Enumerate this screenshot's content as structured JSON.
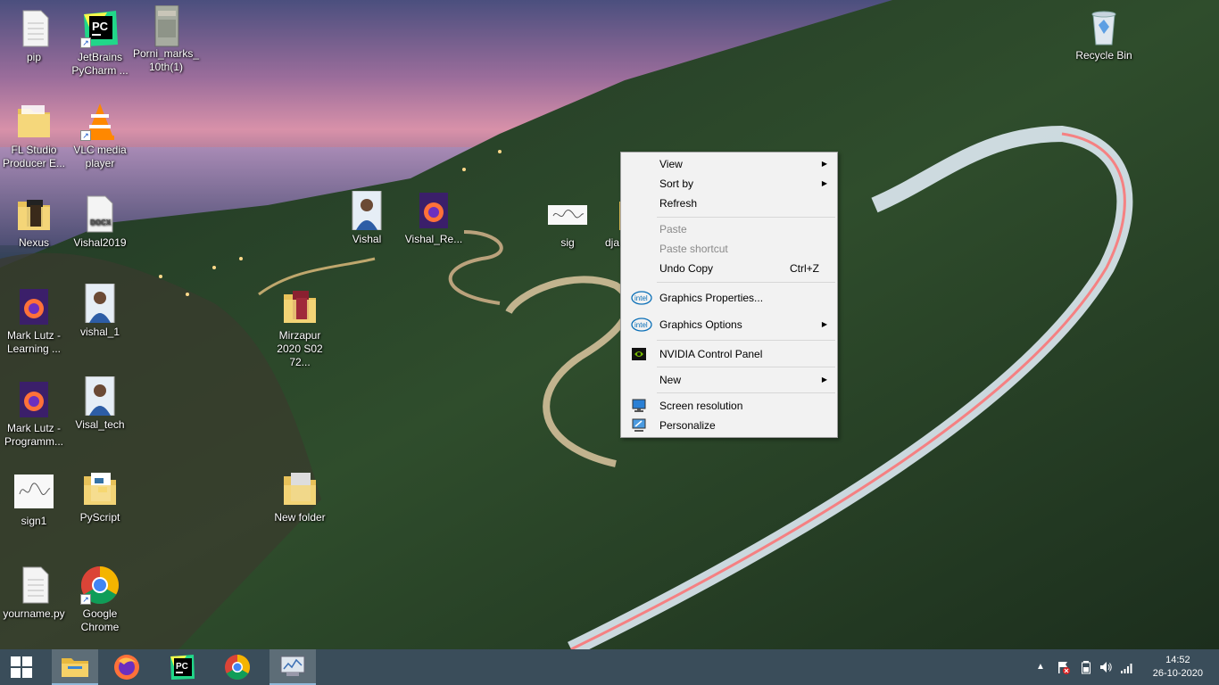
{
  "desktop_icons": [
    {
      "id": "pip",
      "label": "pip",
      "icon": "text-file-icon"
    },
    {
      "id": "pycharm",
      "label": "JetBrains PyCharm ...",
      "icon": "pycharm-icon"
    },
    {
      "id": "porni",
      "label": "Porni_marks_ 10th(1)",
      "icon": "image-file-icon"
    },
    {
      "id": "recycle",
      "label": "Recycle Bin",
      "icon": "recycle-bin-icon"
    },
    {
      "id": "flstudio",
      "label": "FL Studio Producer E...",
      "icon": "folder-icon"
    },
    {
      "id": "vlc",
      "label": "VLC media player",
      "icon": "vlc-icon"
    },
    {
      "id": "nexus",
      "label": "Nexus",
      "icon": "folder-icon"
    },
    {
      "id": "vishal2019",
      "label": "Vishal2019",
      "icon": "docx-icon"
    },
    {
      "id": "vishal",
      "label": "Vishal",
      "icon": "photo-icon"
    },
    {
      "id": "vishal_re",
      "label": "Vishal_Re...",
      "icon": "firefox-pdf-icon"
    },
    {
      "id": "sig",
      "label": "sig",
      "icon": "signature-icon"
    },
    {
      "id": "dja",
      "label": "dja",
      "icon": "folder-icon"
    },
    {
      "id": "marklutz1",
      "label": "Mark Lutz - Learning ...",
      "icon": "firefox-pdf-icon"
    },
    {
      "id": "vishal_1",
      "label": "vishal_1",
      "icon": "photo-icon"
    },
    {
      "id": "mirzapur",
      "label": "Mirzapur 2020 S02 72...",
      "icon": "folder-icon"
    },
    {
      "id": "marklutz2",
      "label": "Mark Lutz - Programm...",
      "icon": "firefox-pdf-icon"
    },
    {
      "id": "visal_tech",
      "label": "Visal_tech",
      "icon": "photo-icon"
    },
    {
      "id": "sign1",
      "label": "sign1",
      "icon": "signature-icon"
    },
    {
      "id": "pyscript",
      "label": "PyScript",
      "icon": "folder-icon"
    },
    {
      "id": "newfolder",
      "label": "New folder",
      "icon": "folder-icon"
    },
    {
      "id": "yourname",
      "label": "yourname.py",
      "icon": "text-file-icon"
    },
    {
      "id": "chrome",
      "label": "Google Chrome",
      "icon": "chrome-icon"
    }
  ],
  "context_menu": {
    "items": [
      {
        "label": "View",
        "has_submenu": true,
        "enabled": true
      },
      {
        "label": "Sort by",
        "has_submenu": true,
        "enabled": true
      },
      {
        "label": "Refresh",
        "has_submenu": false,
        "enabled": true
      },
      {
        "label": "Paste",
        "has_submenu": false,
        "enabled": false
      },
      {
        "label": "Paste shortcut",
        "has_submenu": false,
        "enabled": false
      },
      {
        "label": "Undo Copy",
        "shortcut": "Ctrl+Z",
        "has_submenu": false,
        "enabled": true
      },
      {
        "label": "Graphics Properties...",
        "icon": "intel-icon",
        "has_submenu": false,
        "enabled": true
      },
      {
        "label": "Graphics Options",
        "icon": "intel-icon",
        "has_submenu": true,
        "enabled": true
      },
      {
        "label": "NVIDIA Control Panel",
        "icon": "nvidia-icon",
        "has_submenu": false,
        "enabled": true
      },
      {
        "label": "New",
        "has_submenu": true,
        "enabled": true
      },
      {
        "label": "Screen resolution",
        "icon": "monitor-icon",
        "has_submenu": false,
        "enabled": true
      },
      {
        "label": "Personalize",
        "icon": "personalize-icon",
        "has_submenu": false,
        "enabled": true
      }
    ],
    "intel_badge": "intel"
  },
  "taskbar": {
    "apps": [
      {
        "name": "start-button",
        "icon": "windows-logo-icon"
      },
      {
        "name": "file-explorer",
        "icon": "folder-icon",
        "active": true
      },
      {
        "name": "firefox",
        "icon": "firefox-icon"
      },
      {
        "name": "pycharm",
        "icon": "pycharm-icon"
      },
      {
        "name": "chrome",
        "icon": "chrome-icon"
      },
      {
        "name": "resource-monitor",
        "icon": "monitor-app-icon",
        "active": true
      }
    ],
    "clock": {
      "time": "14:52",
      "date": "26-10-2020"
    }
  },
  "colors": {
    "taskbar": "#3a4d5a",
    "menu_bg": "#f2f2f2",
    "menu_border": "#a0a0a0",
    "disabled_text": "#8a8a8a"
  }
}
